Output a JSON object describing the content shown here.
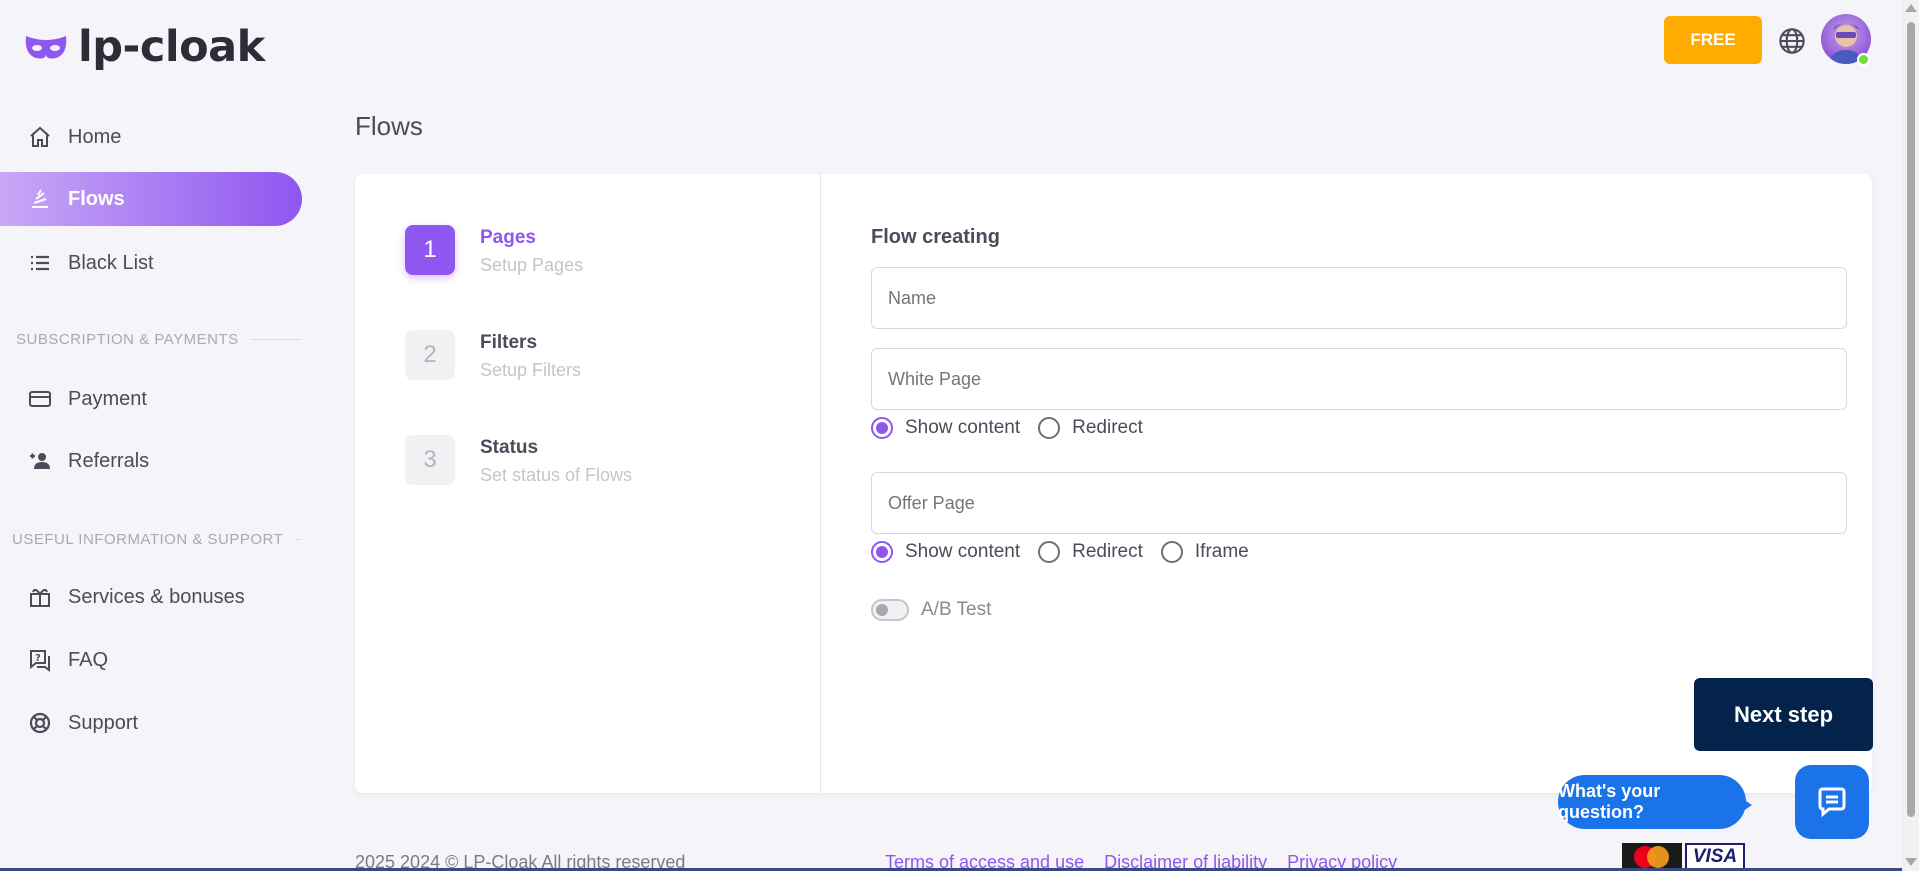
{
  "app": {
    "logo_text": "lp-cloak"
  },
  "sidebar": {
    "items": [
      {
        "label": "Home",
        "icon": "home-icon"
      },
      {
        "label": "Flows",
        "icon": "layers-icon"
      },
      {
        "label": "Black List",
        "icon": "list-icon"
      },
      {
        "label": "Payment",
        "icon": "credit-card-icon"
      },
      {
        "label": "Referrals",
        "icon": "user-plus-icon"
      },
      {
        "label": "Services & bonuses",
        "icon": "gift-icon"
      },
      {
        "label": "FAQ",
        "icon": "question-chat-icon"
      },
      {
        "label": "Support",
        "icon": "lifebuoy-icon"
      }
    ],
    "sections": [
      "SUBSCRIPTION & PAYMENTS",
      "USEFUL INFORMATION & SUPPORT"
    ]
  },
  "topbar": {
    "plan_label": "FREE"
  },
  "page": {
    "title": "Flows"
  },
  "steps": [
    {
      "num": "1",
      "title": "Pages",
      "subtitle": "Setup Pages"
    },
    {
      "num": "2",
      "title": "Filters",
      "subtitle": "Setup Filters"
    },
    {
      "num": "3",
      "title": "Status",
      "subtitle": "Set status of Flows"
    }
  ],
  "form": {
    "title": "Flow creating",
    "name_placeholder": "Name",
    "white_page_placeholder": "White Page",
    "white_options": [
      "Show content",
      "Redirect"
    ],
    "offer_page_placeholder": "Offer Page",
    "offer_options": [
      "Show content",
      "Redirect",
      "Iframe"
    ],
    "ab_test_label": "A/B Test",
    "next_label": "Next step"
  },
  "footer": {
    "copyright": "2025 2024 © LP-Cloak All rights reserved",
    "links": [
      "Terms of access and use",
      "Disclaimer of liability",
      "Privacy policy"
    ],
    "visa": "VISA"
  },
  "chat": {
    "prompt": "What's your question?"
  },
  "colors": {
    "accent": "#8f56f0",
    "free": "#ffab00",
    "next_button": "#03234b",
    "chat": "#1a73e8"
  }
}
